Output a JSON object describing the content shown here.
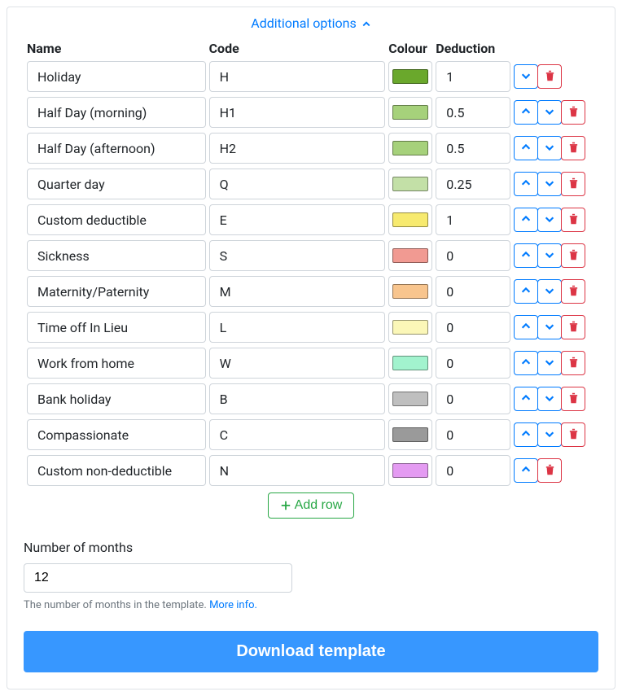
{
  "options_toggle": "Additional options",
  "headers": {
    "name": "Name",
    "code": "Code",
    "colour": "Colour",
    "deduction": "Deduction"
  },
  "rows": [
    {
      "name": "Holiday",
      "code": "H",
      "colour": "#6aa82c",
      "deduction": "1",
      "up": false,
      "down": true
    },
    {
      "name": "Half Day (morning)",
      "code": "H1",
      "colour": "#a6d17b",
      "deduction": "0.5",
      "up": true,
      "down": true
    },
    {
      "name": "Half Day (afternoon)",
      "code": "H2",
      "colour": "#a6d17b",
      "deduction": "0.5",
      "up": true,
      "down": true
    },
    {
      "name": "Quarter day",
      "code": "Q",
      "colour": "#c3e0a7",
      "deduction": "0.25",
      "up": true,
      "down": true
    },
    {
      "name": "Custom deductible",
      "code": "E",
      "colour": "#f7ea6f",
      "deduction": "1",
      "up": true,
      "down": true
    },
    {
      "name": "Sickness",
      "code": "S",
      "colour": "#f19a92",
      "deduction": "0",
      "up": true,
      "down": true
    },
    {
      "name": "Maternity/Paternity",
      "code": "M",
      "colour": "#f8c58e",
      "deduction": "0",
      "up": true,
      "down": true
    },
    {
      "name": "Time off In Lieu",
      "code": "L",
      "colour": "#fbf7b8",
      "deduction": "0",
      "up": true,
      "down": true
    },
    {
      "name": "Work from home",
      "code": "W",
      "colour": "#a2f3ce",
      "deduction": "0",
      "up": true,
      "down": true
    },
    {
      "name": "Bank holiday",
      "code": "B",
      "colour": "#bfbfbf",
      "deduction": "0",
      "up": true,
      "down": true
    },
    {
      "name": "Compassionate",
      "code": "C",
      "colour": "#9a9a9a",
      "deduction": "0",
      "up": true,
      "down": true
    },
    {
      "name": "Custom non-deductible",
      "code": "N",
      "colour": "#e49bf2",
      "deduction": "0",
      "up": true,
      "down": false
    }
  ],
  "add_row_label": "Add row",
  "months": {
    "label": "Number of months",
    "value": "12",
    "help_prefix": "The number of months in the template. ",
    "help_link_text": "More info."
  },
  "download_label": "Download template"
}
